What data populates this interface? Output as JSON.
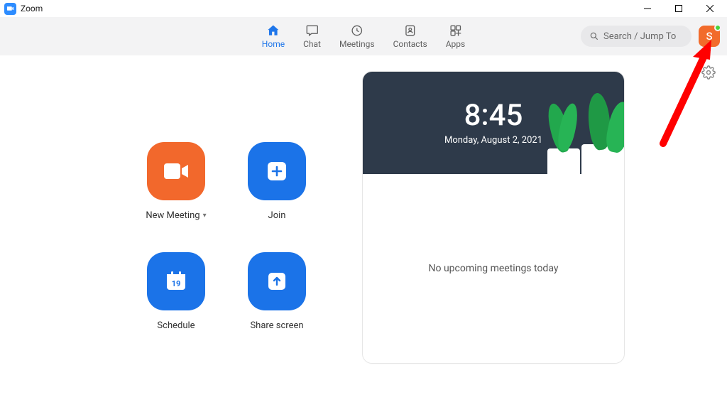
{
  "window": {
    "title": "Zoom"
  },
  "nav": {
    "home": "Home",
    "chat": "Chat",
    "meetings": "Meetings",
    "contacts": "Contacts",
    "apps": "Apps"
  },
  "search": {
    "placeholder": "Search / Jump To"
  },
  "avatar": {
    "initial": "S"
  },
  "actions": {
    "new_meeting": "New Meeting",
    "join": "Join",
    "schedule": "Schedule",
    "share_screen": "Share screen",
    "calendar_day": "19"
  },
  "panel": {
    "time": "8:45",
    "date": "Monday, August 2, 2021",
    "empty_msg": "No upcoming meetings today"
  }
}
